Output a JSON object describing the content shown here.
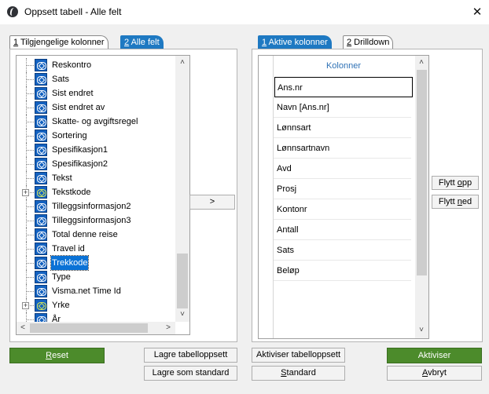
{
  "window": {
    "title": "Oppsett tabell - Alle felt",
    "close_glyph": "✕"
  },
  "left_tabs": [
    {
      "hotkey": "1",
      "label": " Tilgjengelige kolonner",
      "active": false
    },
    {
      "hotkey": "2",
      "label": " Alle felt",
      "active": true
    }
  ],
  "right_tabs": [
    {
      "hotkey": "1",
      "label": " Aktive kolonner",
      "active": true
    },
    {
      "hotkey": "2",
      "label": " Drilldown",
      "active": false
    }
  ],
  "tree": {
    "selected_index": 14,
    "items": [
      {
        "label": "Reskontro",
        "expandable": false
      },
      {
        "label": "Sats",
        "expandable": false
      },
      {
        "label": "Sist endret",
        "expandable": false
      },
      {
        "label": "Sist endret av",
        "expandable": false
      },
      {
        "label": "Skatte- og avgiftsregel",
        "expandable": false
      },
      {
        "label": "Sortering",
        "expandable": false
      },
      {
        "label": "Spesifikasjon1",
        "expandable": false
      },
      {
        "label": "Spesifikasjon2",
        "expandable": false
      },
      {
        "label": "Tekst",
        "expandable": false
      },
      {
        "label": "Tekstkode",
        "expandable": true
      },
      {
        "label": "Tilleggsinformasjon2",
        "expandable": false
      },
      {
        "label": "Tilleggsinformasjon3",
        "expandable": false
      },
      {
        "label": "Total denne reise",
        "expandable": false
      },
      {
        "label": "Travel id",
        "expandable": false
      },
      {
        "label": "Trekkode",
        "expandable": false
      },
      {
        "label": "Type",
        "expandable": false
      },
      {
        "label": "Visma.net Time Id",
        "expandable": false
      },
      {
        "label": "Yrke",
        "expandable": true
      },
      {
        "label": "År",
        "expandable": false
      }
    ],
    "expand_glyph": "+"
  },
  "scroll": {
    "up": "˄",
    "down": "˅",
    "left": "<",
    "right": ">"
  },
  "add_button": ">",
  "columns": {
    "header": "Kolonner",
    "rows": [
      "Ans.nr",
      "Navn [Ans.nr]",
      "Lønnsart",
      "Lønnsartnavn",
      "Avd",
      "Prosj",
      "Kontonr",
      "Antall",
      "Sats",
      "Beløp"
    ]
  },
  "buttons": {
    "move_up": {
      "pre": "Flytt ",
      "key": "o",
      "post": "pp"
    },
    "move_down": {
      "pre": "Flytt ",
      "key": "n",
      "post": "ed"
    },
    "reset": {
      "pre": "",
      "key": "R",
      "post": "eset"
    },
    "save_table_setup": "Lagre tabelloppsett",
    "save_as_default": "Lagre som standard",
    "activate_table_setup": "Aktiviser tabelloppsett",
    "standard": {
      "pre": "",
      "key": "S",
      "post": "tandard"
    },
    "activate": "Aktiviser",
    "cancel": {
      "pre": "",
      "key": "A",
      "post": "vbryt"
    }
  },
  "colors": {
    "accent": "#1e79c2",
    "green": "#4c8b2b",
    "selection": "#0a72d6"
  }
}
